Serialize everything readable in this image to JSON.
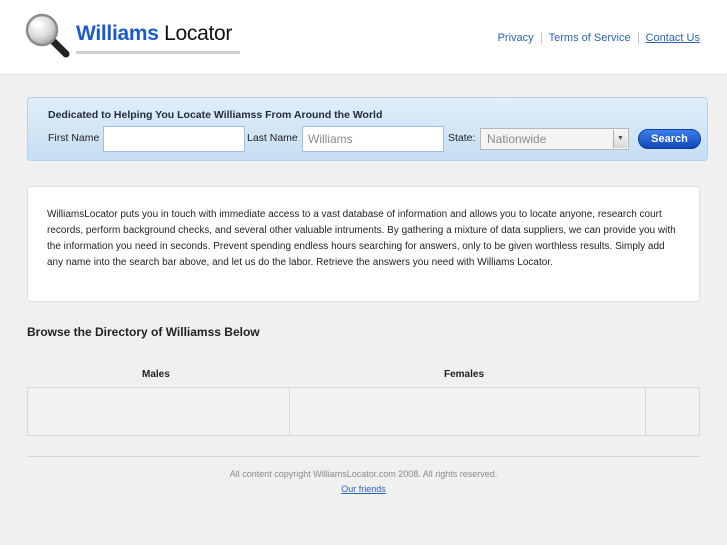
{
  "header": {
    "logo_brand": "Williams",
    "logo_rest": "Locator",
    "nav": [
      {
        "label": "Privacy"
      },
      {
        "label": "Terms of Service"
      },
      {
        "label": "Contact Us"
      }
    ]
  },
  "search": {
    "tagline": "Dedicated to Helping You Locate Williamss From Around the World",
    "first_name_label": "First Name",
    "first_name_value": "",
    "last_name_label": "Last Name",
    "last_name_value": "Williams",
    "state_label": "State:",
    "state_value": "Nationwide",
    "button_label": "Search"
  },
  "intro": {
    "text": "WilliamsLocator puts you in touch with immediate access to a vast database of information and allows you to locate anyone, research court records, perform background checks, and several other valuable intruments. By gathering a mixture of data suppliers, we can provide you with the information you need in seconds. Prevent spending endless hours searching for answers, only to be given worthless results. Simply add any name into the search bar above, and let us do the labor. Retrieve the answers you need with Williams Locator."
  },
  "directory": {
    "title": "Browse the Directory of Williamss Below",
    "males_label": "Males",
    "females_label": "Females"
  },
  "footer": {
    "copyright": "All content copyright WilliamsLocator.com 2008. All rights reserved.",
    "friends_link": "Our friends"
  }
}
